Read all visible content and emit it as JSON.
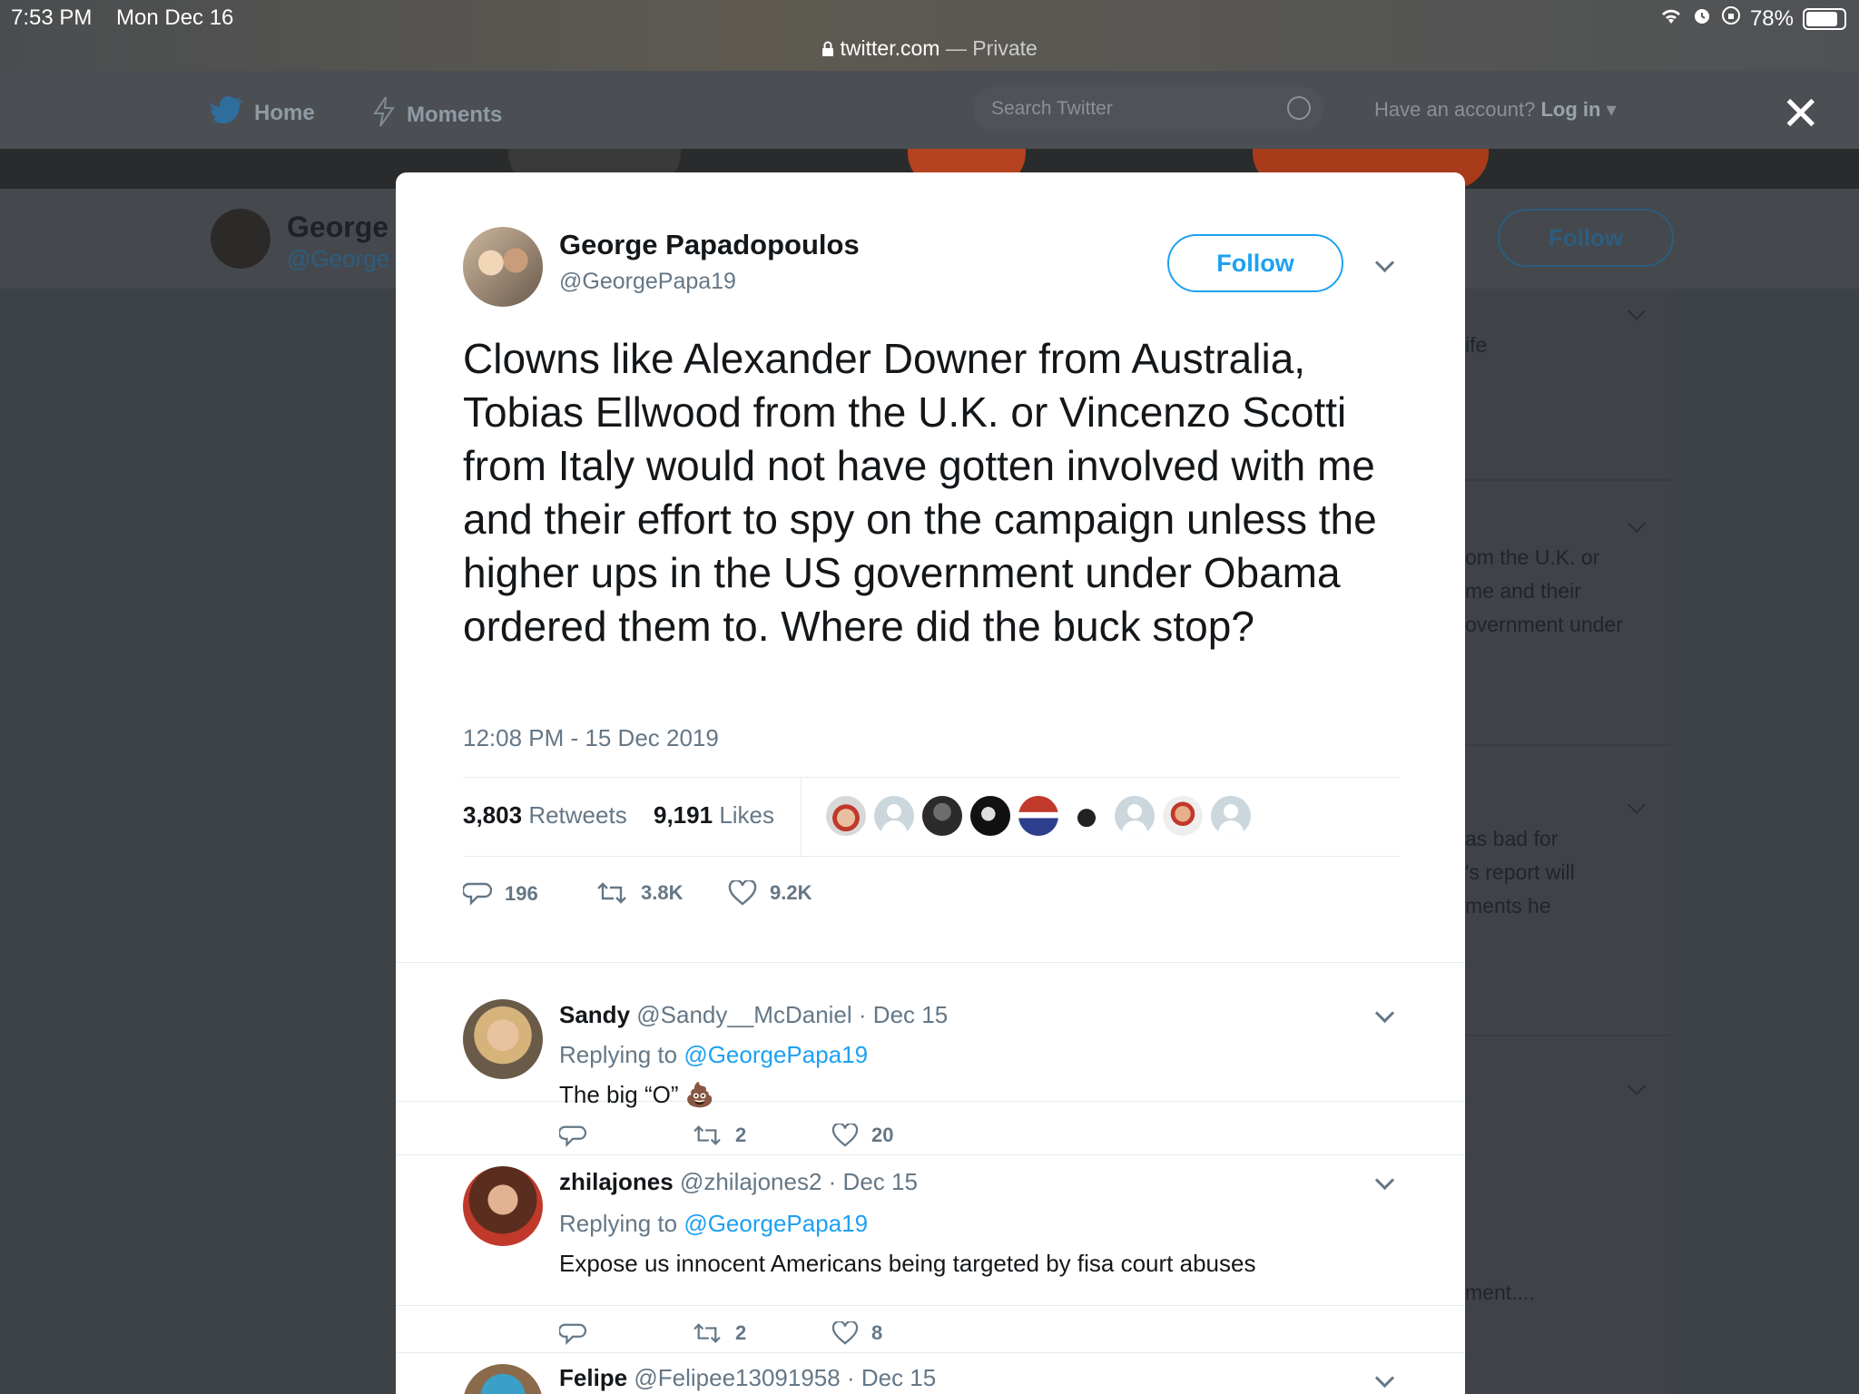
{
  "status_bar": {
    "time": "7:53 PM",
    "date": "Mon Dec 16",
    "battery": "78%"
  },
  "browser": {
    "url": "twitter.com",
    "mode": " — Private"
  },
  "header": {
    "nav": [
      {
        "label": "Home",
        "icon": "twitter-bird-icon"
      },
      {
        "label": "Moments",
        "icon": "lightning-icon"
      }
    ],
    "search_placeholder": "Search Twitter",
    "account_prompt": "Have an account?",
    "login_label": "Log in"
  },
  "background_profile": {
    "name": "George",
    "handle": "@George",
    "follow_label": "Follow"
  },
  "background_timeline": {
    "snippets": [
      "ife",
      "om the U.K. or",
      "me and their",
      "overnment under",
      "as bad for",
      "'s report will",
      "ments he",
      "ment...."
    ]
  },
  "tweet": {
    "author_name": "George Papadopoulos",
    "author_handle": "@GeorgePapa19",
    "follow_label": "Follow",
    "text": "Clowns like Alexander Downer from Australia, Tobias Ellwood from the U.K. or Vincenzo Scotti from Italy would not have gotten involved with me and their effort to spy on the campaign unless the higher ups in the US government under Obama ordered them to. Where did the buck stop?",
    "timestamp": "12:08 PM - 15 Dec 2019",
    "retweets_count": "3,803",
    "retweets_label": "Retweets",
    "likes_count": "9,191",
    "likes_label": "Likes",
    "replies_short": "196",
    "retweets_short": "3.8K",
    "likes_short": "9.2K"
  },
  "replies": [
    {
      "name": "Sandy",
      "handle": "@Sandy__McDaniel",
      "date": "· Dec 15",
      "replying_prefix": "Replying to",
      "replying_to": "@GeorgePapa19",
      "text": "The big “O”",
      "emoji": "💩",
      "retweets": "2",
      "likes": "20"
    },
    {
      "name": "zhilajones",
      "handle": "@zhilajones2",
      "date": "· Dec 15",
      "replying_prefix": "Replying to",
      "replying_to": "@GeorgePapa19",
      "text": "Expose us innocent Americans being targeted by fisa court abuses",
      "retweets": "2",
      "likes": "8"
    },
    {
      "name": "Felipe",
      "handle": "@Felipee13091958",
      "date": "· Dec 15"
    }
  ],
  "colors": {
    "accent": "#1da1f2",
    "text_secondary": "#657786",
    "overlay": "#3d4247"
  }
}
